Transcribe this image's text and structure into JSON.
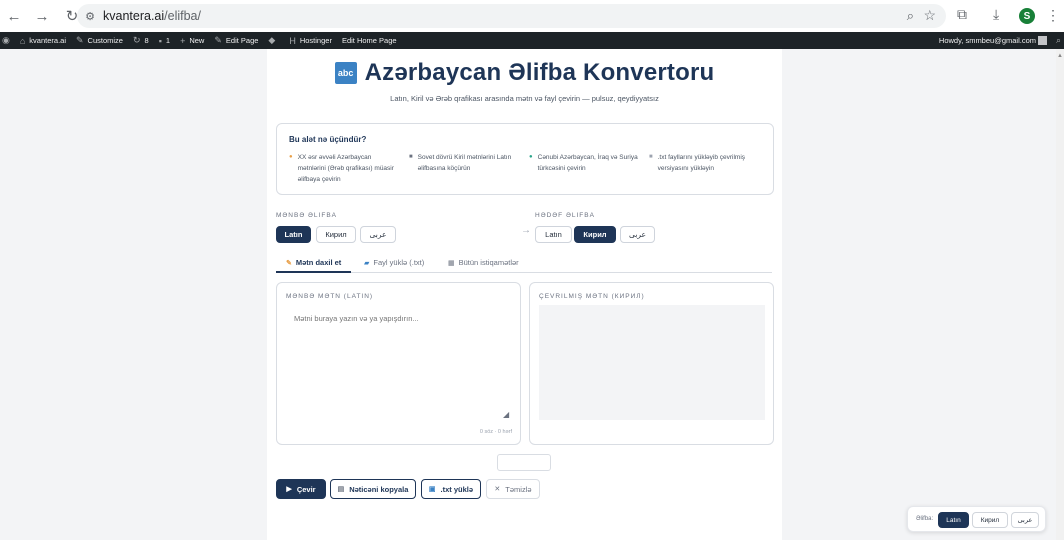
{
  "browser": {
    "url_host": "kvantera.ai",
    "url_path": "/elifba/",
    "profile_initial": "S"
  },
  "wpbar": {
    "site": "kvantera.ai",
    "customize": "Customize",
    "updates": "8",
    "comments": "1",
    "new": "New",
    "edit_page": "Edit Page",
    "hostinger": "Hostinger",
    "edit_home": "Edit Home Page",
    "howdy": "Howdy, smmbeu@gmail.com"
  },
  "header": {
    "logo_text": "abc",
    "title": "Azərbaycan Əlifba Konvertoru",
    "subtitle": "Latın, Kiril və Ərəb qrafikası arasında mətn və fayl çevirin — pulsuz, qeydiyyatsız"
  },
  "info": {
    "heading": "Bu alət nə üçündür?",
    "features": [
      {
        "bullet": "●",
        "text": "XX əsr əvvəli Azərbaycan mətnlərini (Ərəb qrafikası) müasir əlifbaya çevirin"
      },
      {
        "bullet": "■",
        "text": "Sovet dövrü Kiril mətnlərini Latın əlifbasına köçürün"
      },
      {
        "bullet": "●",
        "text": "Cənubi Azərbaycan, İraq və Suriya türkcəsini çevirin"
      },
      {
        "bullet": "■",
        "text": ".txt fayllarını yükləyib çevrilmiş versiyasını yükləyin"
      }
    ]
  },
  "source": {
    "label": "Mənbə əlifba",
    "options": [
      "Latın",
      "Кирил",
      "عربی"
    ],
    "selected": "Latın"
  },
  "target": {
    "label": "Hədəf əlifba",
    "options": [
      "Latın",
      "Кирил",
      "عربی"
    ],
    "selected": "Кирил"
  },
  "arrow": "→",
  "tabs": [
    {
      "icon": "✎",
      "label": "Mətn daxil et"
    },
    {
      "icon": "▰",
      "label": "Fayl yüklə (.txt)"
    },
    {
      "icon": "▦",
      "label": "Bütün istiqamətlər"
    }
  ],
  "input_panel": {
    "label": "MƏNBƏ MƏTN (LATIN)",
    "placeholder": "Mətni buraya yazın və ya yapışdırın...",
    "count": "0 söz · 0 hərf"
  },
  "output_panel": {
    "label": "ÇEVRILMIŞ MƏTN (КИРИЛ)"
  },
  "actions": {
    "convert": "Çevir",
    "copy": "Nəticəni kopyala",
    "download": ".txt yüklə",
    "clear": "Təmizlə"
  },
  "floater": {
    "label": "Əlifba:",
    "options": [
      "Latın",
      "Кирил",
      "عربی"
    ],
    "selected": "Latın"
  }
}
